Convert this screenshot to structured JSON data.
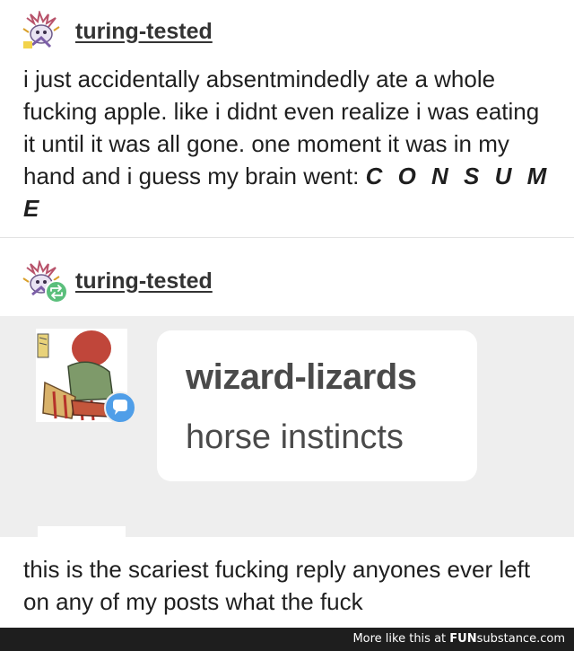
{
  "post": {
    "username": "turing-tested",
    "text_before": "i just accidentally absentmindedly ate a whole fucking apple. like i didnt even realize i was eating it until it was all gone. one moment it was in my hand and i guess my brain went: ",
    "text_emphasis": "C O N S U M E"
  },
  "reblog": {
    "username": "turing-tested",
    "reply_card": {
      "username": "wizard-lizards",
      "text": "horse instincts"
    },
    "comment": "this is the scariest fucking reply anyones ever left on any of my posts what the fuck"
  },
  "footer": {
    "prefix": "More like this at ",
    "brand_bold": "FUN",
    "brand_rest": "substance",
    "suffix": ".com"
  },
  "icons": {
    "reblog_badge": "reblog-icon",
    "reply_badge": "speech-bubble-icon"
  },
  "colors": {
    "reblog_badge": "#5bbf7c",
    "reply_badge": "#4f9ee8",
    "reply_background": "#eeeeee",
    "footer": "#1e1e1e"
  }
}
